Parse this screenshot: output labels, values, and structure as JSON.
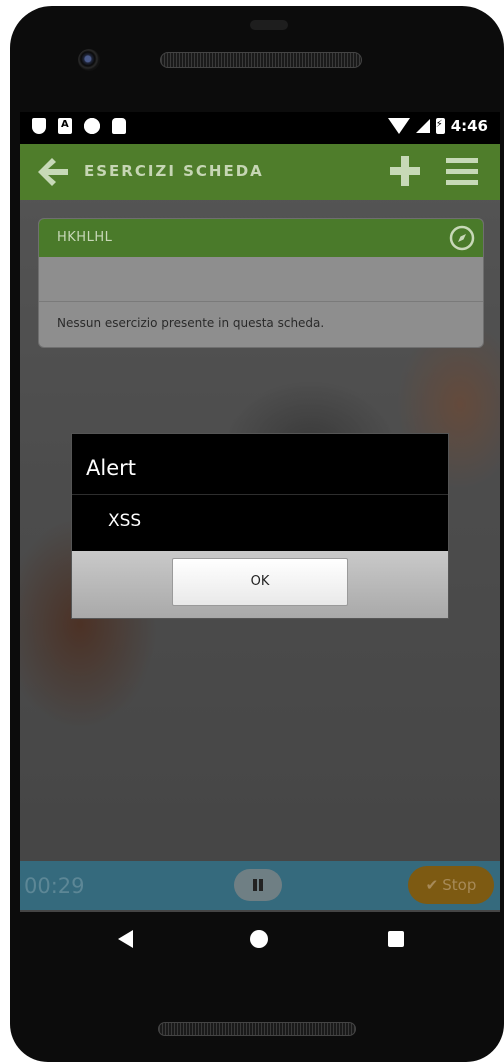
{
  "statusbar": {
    "time": "4:46"
  },
  "appbar": {
    "title": "ESERCIZI SCHEDA"
  },
  "card": {
    "title": "HKHLHL",
    "empty_message": "Nessun esercizio presente in questa scheda."
  },
  "dialog": {
    "title": "Alert",
    "message": "XSS",
    "ok_label": "OK"
  },
  "timer": {
    "elapsed": "00:29",
    "stop_label": "Stop"
  },
  "colors": {
    "appbar": "#4f7d2b",
    "timer_bar": "#356a7d",
    "stop_button": "#7d5a12",
    "dialog_background": "#000000"
  },
  "icons": [
    "back-arrow-icon",
    "plus-icon",
    "menu-icon",
    "compass-icon",
    "pause-icon",
    "check-icon"
  ]
}
